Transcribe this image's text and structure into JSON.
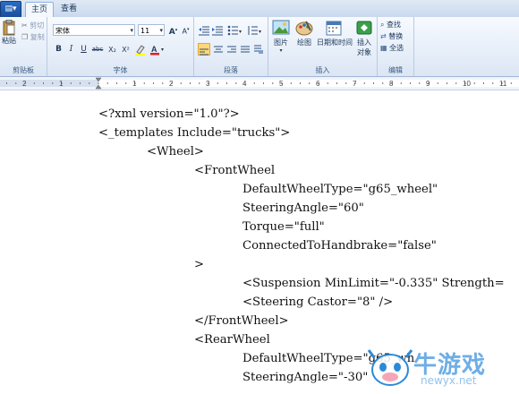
{
  "tabs": [
    {
      "label": "主页",
      "active": true
    },
    {
      "label": "查看",
      "active": false
    }
  ],
  "ribbon": {
    "clipboard": {
      "group_label": "剪贴板",
      "paste_label": "粘贴",
      "cut_label": "剪切",
      "copy_label": "复制"
    },
    "font": {
      "group_label": "字体",
      "font_name": "宋体",
      "font_size": "11",
      "bold": "B",
      "italic": "I",
      "underline": "U",
      "strike": "abc",
      "subscript": "X₂",
      "superscript": "X²",
      "grow": "A",
      "shrink": "A"
    },
    "paragraph": {
      "group_label": "段落"
    },
    "insert": {
      "group_label": "插入",
      "picture_label": "图片",
      "paint_label": "绘图",
      "datetime_label": "日期和时间",
      "object_label_1": "插入",
      "object_label_2": "对象"
    },
    "editing": {
      "group_label": "编辑",
      "find_label": "查找",
      "replace_label": "替换",
      "selectall_label": "全选"
    }
  },
  "ruler": {
    "numbers": [
      "2",
      "1",
      "1",
      "2",
      "3",
      "4",
      "5",
      "6",
      "7",
      "8",
      "9",
      "10",
      "11"
    ]
  },
  "document": {
    "lines": [
      "<?xml version=\"1.0\"?>",
      "<_templates Include=\"trucks\">",
      "<Wheel>",
      "<FrontWheel",
      "DefaultWheelType=\"g65_wheel\"",
      "SteeringAngle=\"60\"",
      "Torque=\"full\"",
      "ConnectedToHandbrake=\"false\"",
      ">",
      "<Suspension MinLimit=\"-0.335\" Strength=",
      "<Steering Castor=\"8\" />",
      "</FrontWheel>",
      "<RearWheel",
      "DefaultWheelType=\"g65_wh",
      "SteeringAngle=\"-30\""
    ]
  },
  "watermark": {
    "text": "牛游戏",
    "url": "newyx.net"
  },
  "colors": {
    "accent": "#2b6cc4",
    "ribbon_border": "#8db2e3",
    "app_button": "#1a4f9c"
  }
}
